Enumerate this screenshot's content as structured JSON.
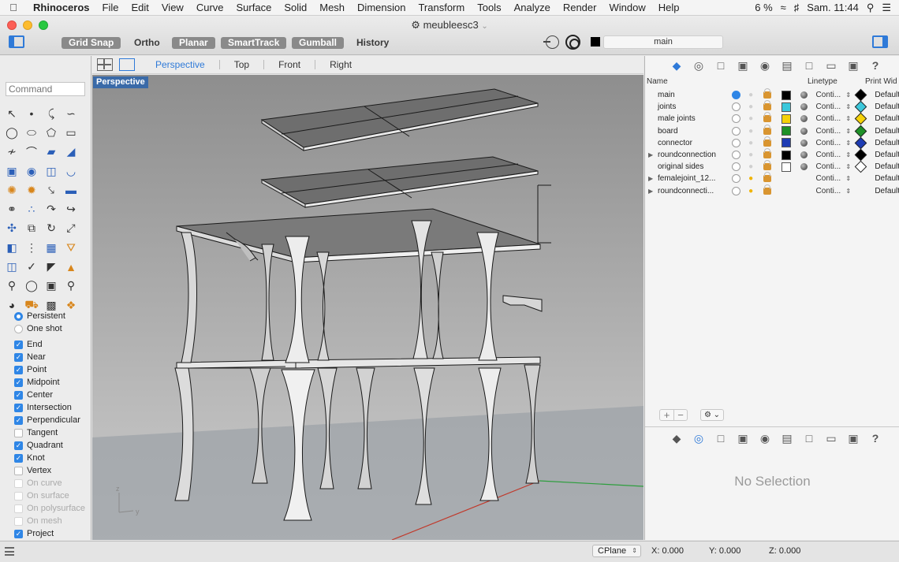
{
  "menubar": {
    "app_name": "Rhinoceros",
    "items": [
      "File",
      "Edit",
      "View",
      "Curve",
      "Surface",
      "Solid",
      "Mesh",
      "Dimension",
      "Transform",
      "Tools",
      "Analyze",
      "Render",
      "Window",
      "Help"
    ],
    "battery": "6 %",
    "clock": "Sam. 11:44"
  },
  "window": {
    "document_title": "meubleesc3"
  },
  "toolbar": {
    "grid_snap": "Grid Snap",
    "ortho": "Ortho",
    "planar": "Planar",
    "smarttrack": "SmartTrack",
    "gumball": "Gumball",
    "history": "History",
    "current_layer": "main"
  },
  "command": {
    "placeholder": "Command"
  },
  "osnap": {
    "mode_options": [
      {
        "label": "Persistent",
        "selected": true
      },
      {
        "label": "One shot",
        "selected": false
      }
    ],
    "snaps": [
      {
        "label": "End",
        "checked": true,
        "enabled": true
      },
      {
        "label": "Near",
        "checked": true,
        "enabled": true
      },
      {
        "label": "Point",
        "checked": true,
        "enabled": true
      },
      {
        "label": "Midpoint",
        "checked": true,
        "enabled": true
      },
      {
        "label": "Center",
        "checked": true,
        "enabled": true
      },
      {
        "label": "Intersection",
        "checked": true,
        "enabled": true
      },
      {
        "label": "Perpendicular",
        "checked": true,
        "enabled": true
      },
      {
        "label": "Tangent",
        "checked": false,
        "enabled": true
      },
      {
        "label": "Quadrant",
        "checked": true,
        "enabled": true
      },
      {
        "label": "Knot",
        "checked": true,
        "enabled": true
      },
      {
        "label": "Vertex",
        "checked": false,
        "enabled": true
      },
      {
        "label": "On curve",
        "checked": false,
        "enabled": false
      },
      {
        "label": "On surface",
        "checked": false,
        "enabled": false
      },
      {
        "label": "On polysurface",
        "checked": false,
        "enabled": false
      },
      {
        "label": "On mesh",
        "checked": false,
        "enabled": false
      },
      {
        "label": "Project",
        "checked": true,
        "enabled": true
      }
    ]
  },
  "viewport": {
    "tabs": [
      "Perspective",
      "Top",
      "Front",
      "Right"
    ],
    "active_tab": "Perspective",
    "active_label": "Perspective",
    "axis_labels": {
      "z": "z",
      "y": "y"
    }
  },
  "layers": {
    "columns": {
      "name": "Name",
      "linetype": "Linetype",
      "print_width": "Print Wid"
    },
    "rows": [
      {
        "name": "main",
        "current": true,
        "light": "off",
        "color": "#000000",
        "linetype": "Conti...",
        "print_color": "#000000",
        "print_width": "Default",
        "expandable": false
      },
      {
        "name": "joints",
        "current": false,
        "light": "off",
        "color": "#3cc8dc",
        "linetype": "Conti...",
        "print_color": "#3cc8dc",
        "print_width": "Default",
        "expandable": false
      },
      {
        "name": "male joints",
        "current": false,
        "light": "off",
        "color": "#f5d20a",
        "linetype": "Conti...",
        "print_color": "#f5d20a",
        "print_width": "Default",
        "expandable": false
      },
      {
        "name": "board",
        "current": false,
        "light": "off",
        "color": "#1e9128",
        "linetype": "Conti...",
        "print_color": "#1e9128",
        "print_width": "Default",
        "expandable": false
      },
      {
        "name": "connector",
        "current": false,
        "light": "off",
        "color": "#1e3cb4",
        "linetype": "Conti...",
        "print_color": "#1e3cb4",
        "print_width": "Default",
        "expandable": false
      },
      {
        "name": "roundconnection",
        "current": false,
        "light": "off",
        "color": "#000000",
        "linetype": "Conti...",
        "print_color": "#000000",
        "print_width": "Default",
        "expandable": true
      },
      {
        "name": "original sides",
        "current": false,
        "light": "off",
        "color": "#ffffff",
        "linetype": "Conti...",
        "print_color": "#ffffff",
        "print_width": "Default",
        "expandable": false
      },
      {
        "name": "femalejoint_12...",
        "current": false,
        "light": "on",
        "color": "",
        "linetype": "Conti...",
        "print_color": "",
        "print_width": "Default",
        "expandable": true
      },
      {
        "name": "roundconnecti...",
        "current": false,
        "light": "on",
        "color": "",
        "linetype": "Conti...",
        "print_color": "",
        "print_width": "Default",
        "expandable": true
      }
    ]
  },
  "properties": {
    "empty_text": "No Selection"
  },
  "statusbar": {
    "cplane": "CPlane",
    "x": "X: 0.000",
    "y": "Y: 0.000",
    "z": "Z: 0.000"
  },
  "colors": {
    "accent": "#2f7ad8",
    "viewport_bg_top": "#8f8f8f",
    "viewport_bg_bottom": "#c8c8c8",
    "ground": "#9aa0a6"
  }
}
